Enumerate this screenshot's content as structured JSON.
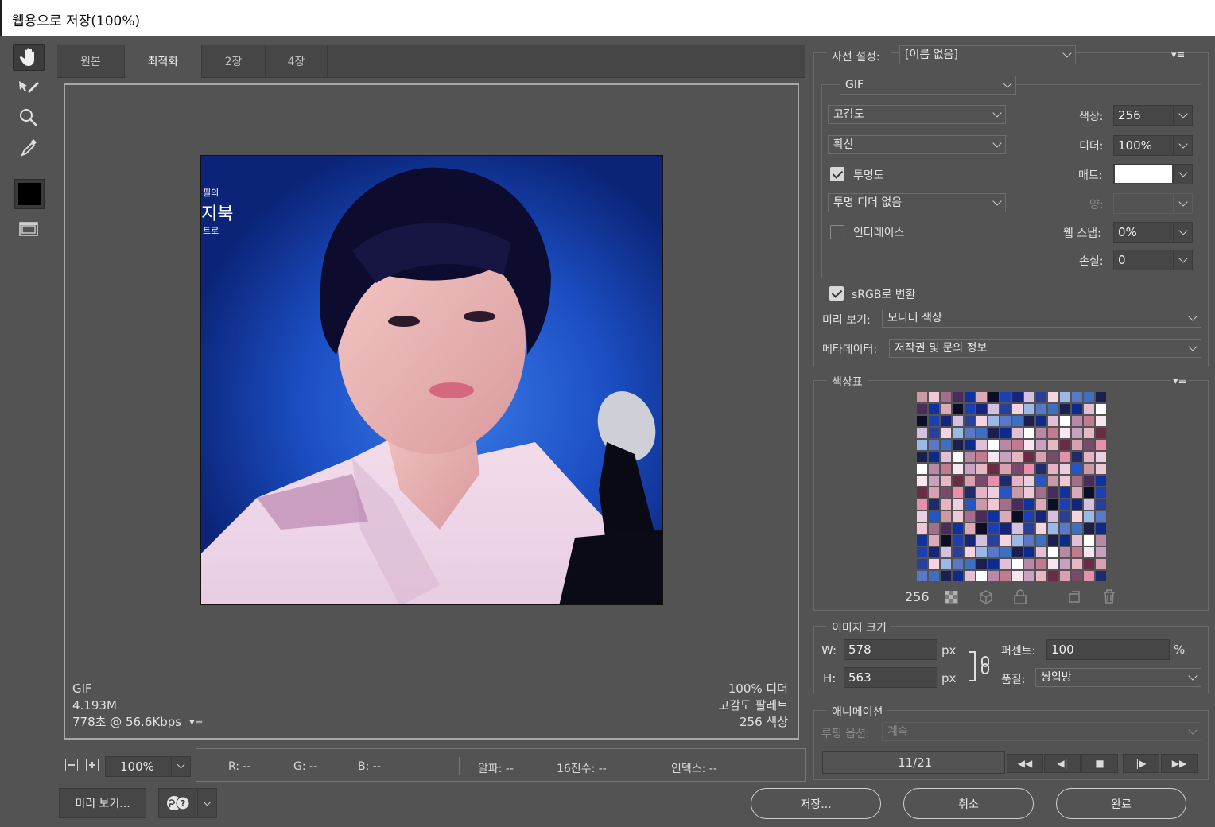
{
  "window": {
    "title": "웹용으로 저장(100%)"
  },
  "tabs": [
    "원본",
    "최적화",
    "2장",
    "4장"
  ],
  "preview": {
    "sign_lines": [
      "필의",
      "지북",
      "트로"
    ],
    "left_info": [
      "GIF",
      "4.193M",
      "778초 @ 56.6Kbps"
    ],
    "right_info": [
      "100% 디더",
      "고감도 팔레트",
      "256 색상"
    ]
  },
  "status": {
    "zoom": "100%",
    "r": "R: --",
    "g": "G: --",
    "b": "B: --",
    "alpha": "알파: --",
    "hex": "16진수: --",
    "index": "인덱스: --"
  },
  "bottom_buttons": {
    "preview": "미리 보기...",
    "save": "저장...",
    "cancel": "취소",
    "done": "완료"
  },
  "settings": {
    "preset_label": "사전 설정:",
    "preset_value": "[이름 없음]",
    "format": "GIF",
    "reduction": "고감도",
    "dither_algo": "확산",
    "transparency_label": "투명도",
    "transparency_dither": "투명 디더 없음",
    "interlace_label": "인터레이스",
    "colors_label": "색상:",
    "colors_value": "256",
    "dither_label": "디더:",
    "dither_value": "100%",
    "matte_label": "매트:",
    "amount_label": "양:",
    "websnap_label": "웹 스냅:",
    "websnap_value": "0%",
    "lossy_label": "손실:",
    "lossy_value": "0",
    "srgb_label": "sRGB로 변환",
    "preview_label": "미리 보기:",
    "preview_value": "모니터 색상",
    "metadata_label": "메타데이터:",
    "metadata_value": "저작권 및 문의 정보"
  },
  "color_table": {
    "title": "색상표",
    "count": "256",
    "colors": [
      "#c99aa6",
      "#e7b7c2",
      "#3f6fc0",
      "#dba9b8",
      "#1f2b6b",
      "#b889a6",
      "#2a3f9a",
      "#f0c7d5",
      "#6a2b45",
      "#1a1f4e",
      "#0b0e25",
      "#e6b3c4",
      "#c27a8f",
      "#f5d3e0",
      "#a36e8a",
      "#d8a0b0"
    ],
    "palette_seed": [
      "#c99aa6",
      "#e7b7c2",
      "#3f6fc0",
      "#dba9b8",
      "#1f2b6b",
      "#b889a6",
      "#2a3f9a",
      "#f0c7d5",
      "#6a2b45",
      "#1a1f4e",
      "#0b0e25",
      "#e6b3c4",
      "#c27a8f",
      "#f5d3e0",
      "#a36e8a",
      "#d8a0b0",
      "#0d2a8c",
      "#1c3fb4",
      "#eacfe0",
      "#f7e6ef",
      "#9bb8e8",
      "#4a2c5c",
      "#7a4a6c",
      "#e1c0d6",
      "#16247a",
      "#2456c8",
      "#c8a0c0",
      "#5a78c8",
      "#1032a0",
      "#e98fae",
      "#ffffff",
      "#d6c0e0"
    ]
  },
  "image_size": {
    "title": "이미지 크기",
    "w_label": "W:",
    "w_value": "578",
    "w_unit": "px",
    "h_label": "H:",
    "h_value": "563",
    "h_unit": "px",
    "percent_label": "퍼센트:",
    "percent_value": "100",
    "percent_unit": "%",
    "quality_label": "품질:",
    "quality_value": "쌍입방"
  },
  "animation": {
    "title": "애니메이션",
    "loop_label": "루핑 옵션:",
    "loop_value": "계속",
    "frame": "11/21"
  }
}
